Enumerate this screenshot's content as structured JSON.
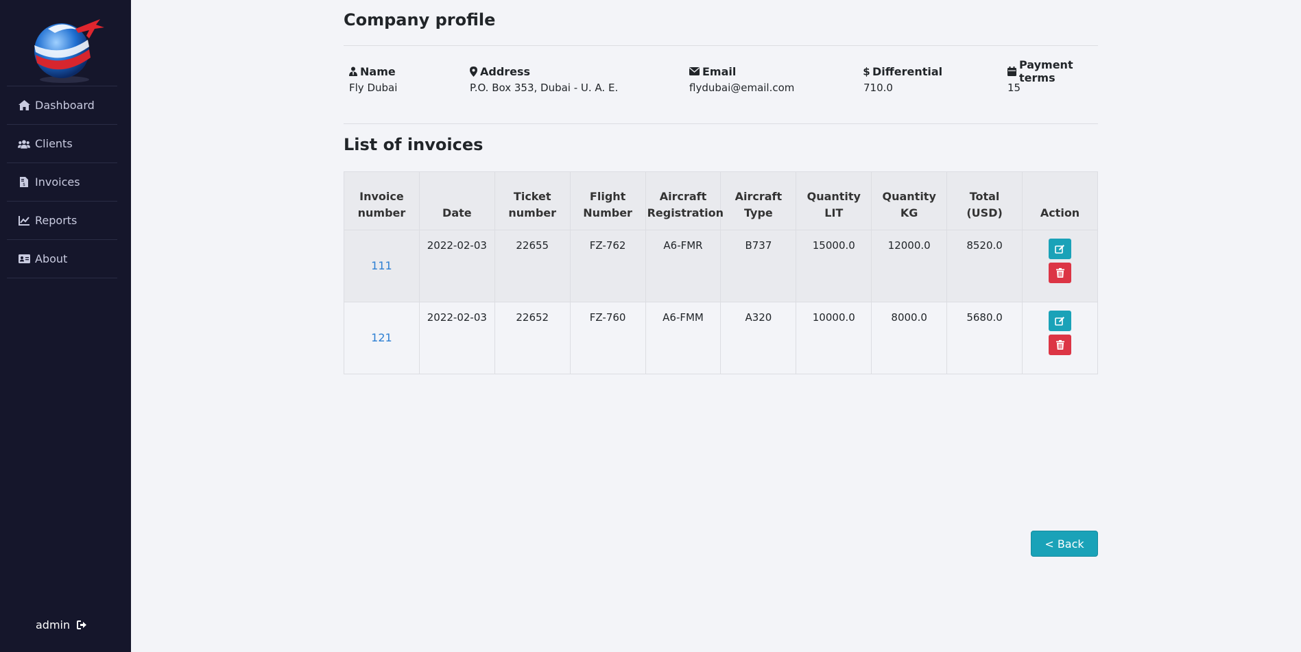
{
  "sidebar": {
    "items": [
      {
        "label": "Dashboard",
        "icon": "home-icon"
      },
      {
        "label": "Clients",
        "icon": "users-icon"
      },
      {
        "label": "Invoices",
        "icon": "invoice-file-icon"
      },
      {
        "label": "Reports",
        "icon": "chart-line-icon"
      },
      {
        "label": "About",
        "icon": "id-card-icon"
      }
    ],
    "user": "admin"
  },
  "company": {
    "title": "Company profile",
    "name_label": "Name",
    "name": "Fly Dubai",
    "address_label": "Address",
    "address": "P.O. Box 353, Dubai - U. A. E.",
    "email_label": "Email",
    "email": "flydubai@email.com",
    "differential_label": "Differential",
    "differential": "710.0",
    "payment_terms_label": "Payment terms",
    "payment_terms": "15"
  },
  "invoices": {
    "title": "List of invoices",
    "headers": [
      [
        "Invoice",
        "number"
      ],
      [
        "Date"
      ],
      [
        "Ticket",
        "number"
      ],
      [
        "Flight",
        "Number"
      ],
      [
        "Aircraft",
        "Registration"
      ],
      [
        "Aircraft",
        "Type"
      ],
      [
        "Quantity",
        "LIT"
      ],
      [
        "Quantity",
        "KG"
      ],
      [
        "Total",
        "(USD)"
      ],
      [
        "Action"
      ]
    ],
    "rows": [
      {
        "invoice": "111",
        "date": "2022-02-03",
        "ticket": "22655",
        "flight": "FZ-762",
        "registration": "A6-FMR",
        "type": "B737",
        "qty_lit": "15000.0",
        "qty_kg": "12000.0",
        "total": "8520.0"
      },
      {
        "invoice": "121",
        "date": "2022-02-03",
        "ticket": "22652",
        "flight": "FZ-760",
        "registration": "A6-FMM",
        "type": "A320",
        "qty_lit": "10000.0",
        "qty_kg": "8000.0",
        "total": "5680.0"
      }
    ]
  },
  "back_label": "< Back",
  "colors": {
    "sidebar_bg": "#15162b",
    "page_bg": "#f3f4f8",
    "info_button": "#1aa2b8",
    "danger_button": "#dc3545",
    "link": "#2d7fd3"
  }
}
